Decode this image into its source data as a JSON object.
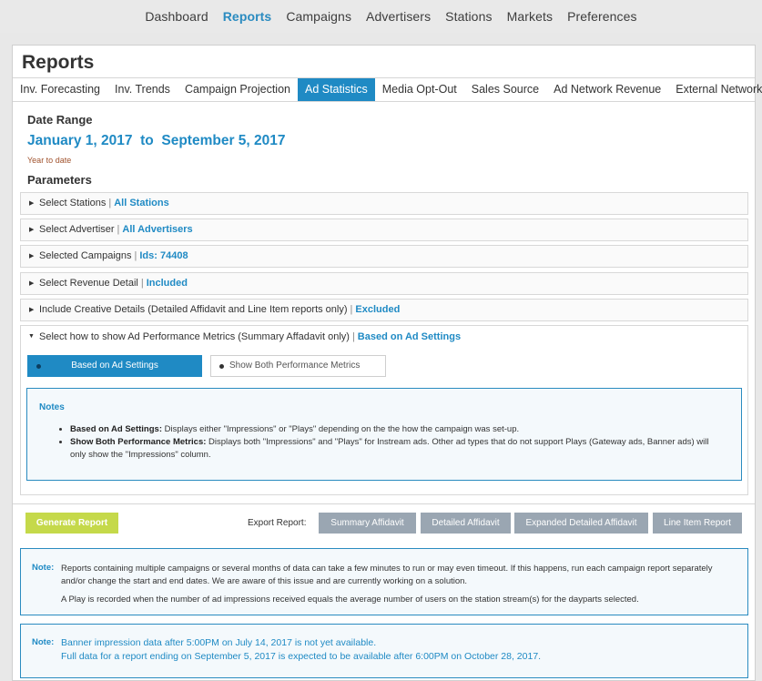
{
  "nav": {
    "items": [
      "Dashboard",
      "Reports",
      "Campaigns",
      "Advertisers",
      "Stations",
      "Markets",
      "Preferences"
    ],
    "active": "Reports"
  },
  "page": {
    "title": "Reports"
  },
  "tabs": [
    "Inv. Forecasting",
    "Inv. Trends",
    "Campaign Projection",
    "Ad Statistics",
    "Media Opt-Out",
    "Sales Source",
    "Ad Network Revenue",
    "External Network"
  ],
  "active_tab": "Ad Statistics",
  "date_range": {
    "heading": "Date Range",
    "start": "January 1, 2017",
    "to": "to",
    "end": "September 5, 2017",
    "sub": "Year to date"
  },
  "parameters": {
    "heading": "Parameters",
    "items": [
      {
        "label": "Select Stations",
        "value": "All Stations"
      },
      {
        "label": "Select Advertiser",
        "value": "All Advertisers"
      },
      {
        "label": "Selected Campaigns",
        "value": "Ids: 74408"
      },
      {
        "label": "Select Revenue Detail",
        "value": "Included"
      },
      {
        "label": "Include Creative Details (Detailed Affidavit and Line Item reports only)",
        "value": "Excluded"
      }
    ],
    "expanded": {
      "label": "Select how to show Ad Performance Metrics (Summary Affadavit only)",
      "value": "Based on Ad Settings",
      "options": [
        "Based on Ad Settings",
        "Show Both Performance Metrics"
      ],
      "selected": "Based on Ad Settings",
      "notes": {
        "title": "Notes",
        "items": [
          {
            "term": "Based on Ad Settings:",
            "text": " Displays either \"Impressions\" or \"Plays\" depending on the the how the campaign was set-up."
          },
          {
            "term": "Show Both Performance Metrics:",
            "text": " Displays both \"Impressions\" and \"Plays\" for Instream ads. Other ad types that do not support Plays (Gateway ads, Banner ads) will only show the \"Impressions\" column."
          }
        ]
      }
    }
  },
  "actions": {
    "generate": "Generate Report",
    "export_label": "Export Report:",
    "exports": [
      "Summary Affidavit",
      "Detailed Affidavit",
      "Expanded Detailed Affidavit",
      "Line Item Report"
    ]
  },
  "notes": [
    {
      "label": "Note:",
      "lines": [
        "Reports containing multiple campaigns or several months of data can take a few minutes to run or may even timeout. If this happens, run each campaign report separately and/or change the start and end dates. We are aware of this issue and are currently working on a solution.",
        "A Play is recorded when the number of ad impressions received equals the average number of users on the station stream(s) for the dayparts selected."
      ]
    },
    {
      "label": "Note:",
      "lines": [
        "Banner impression data after 5:00PM on July 14, 2017 is not yet available.",
        "Full data for a report ending on September 5, 2017 is expected to be available after 6:00PM on October 28, 2017."
      ]
    }
  ],
  "colors": {
    "accent": "#1f8ac4",
    "generate": "#c5d94a",
    "export": "#9aa6b2"
  }
}
